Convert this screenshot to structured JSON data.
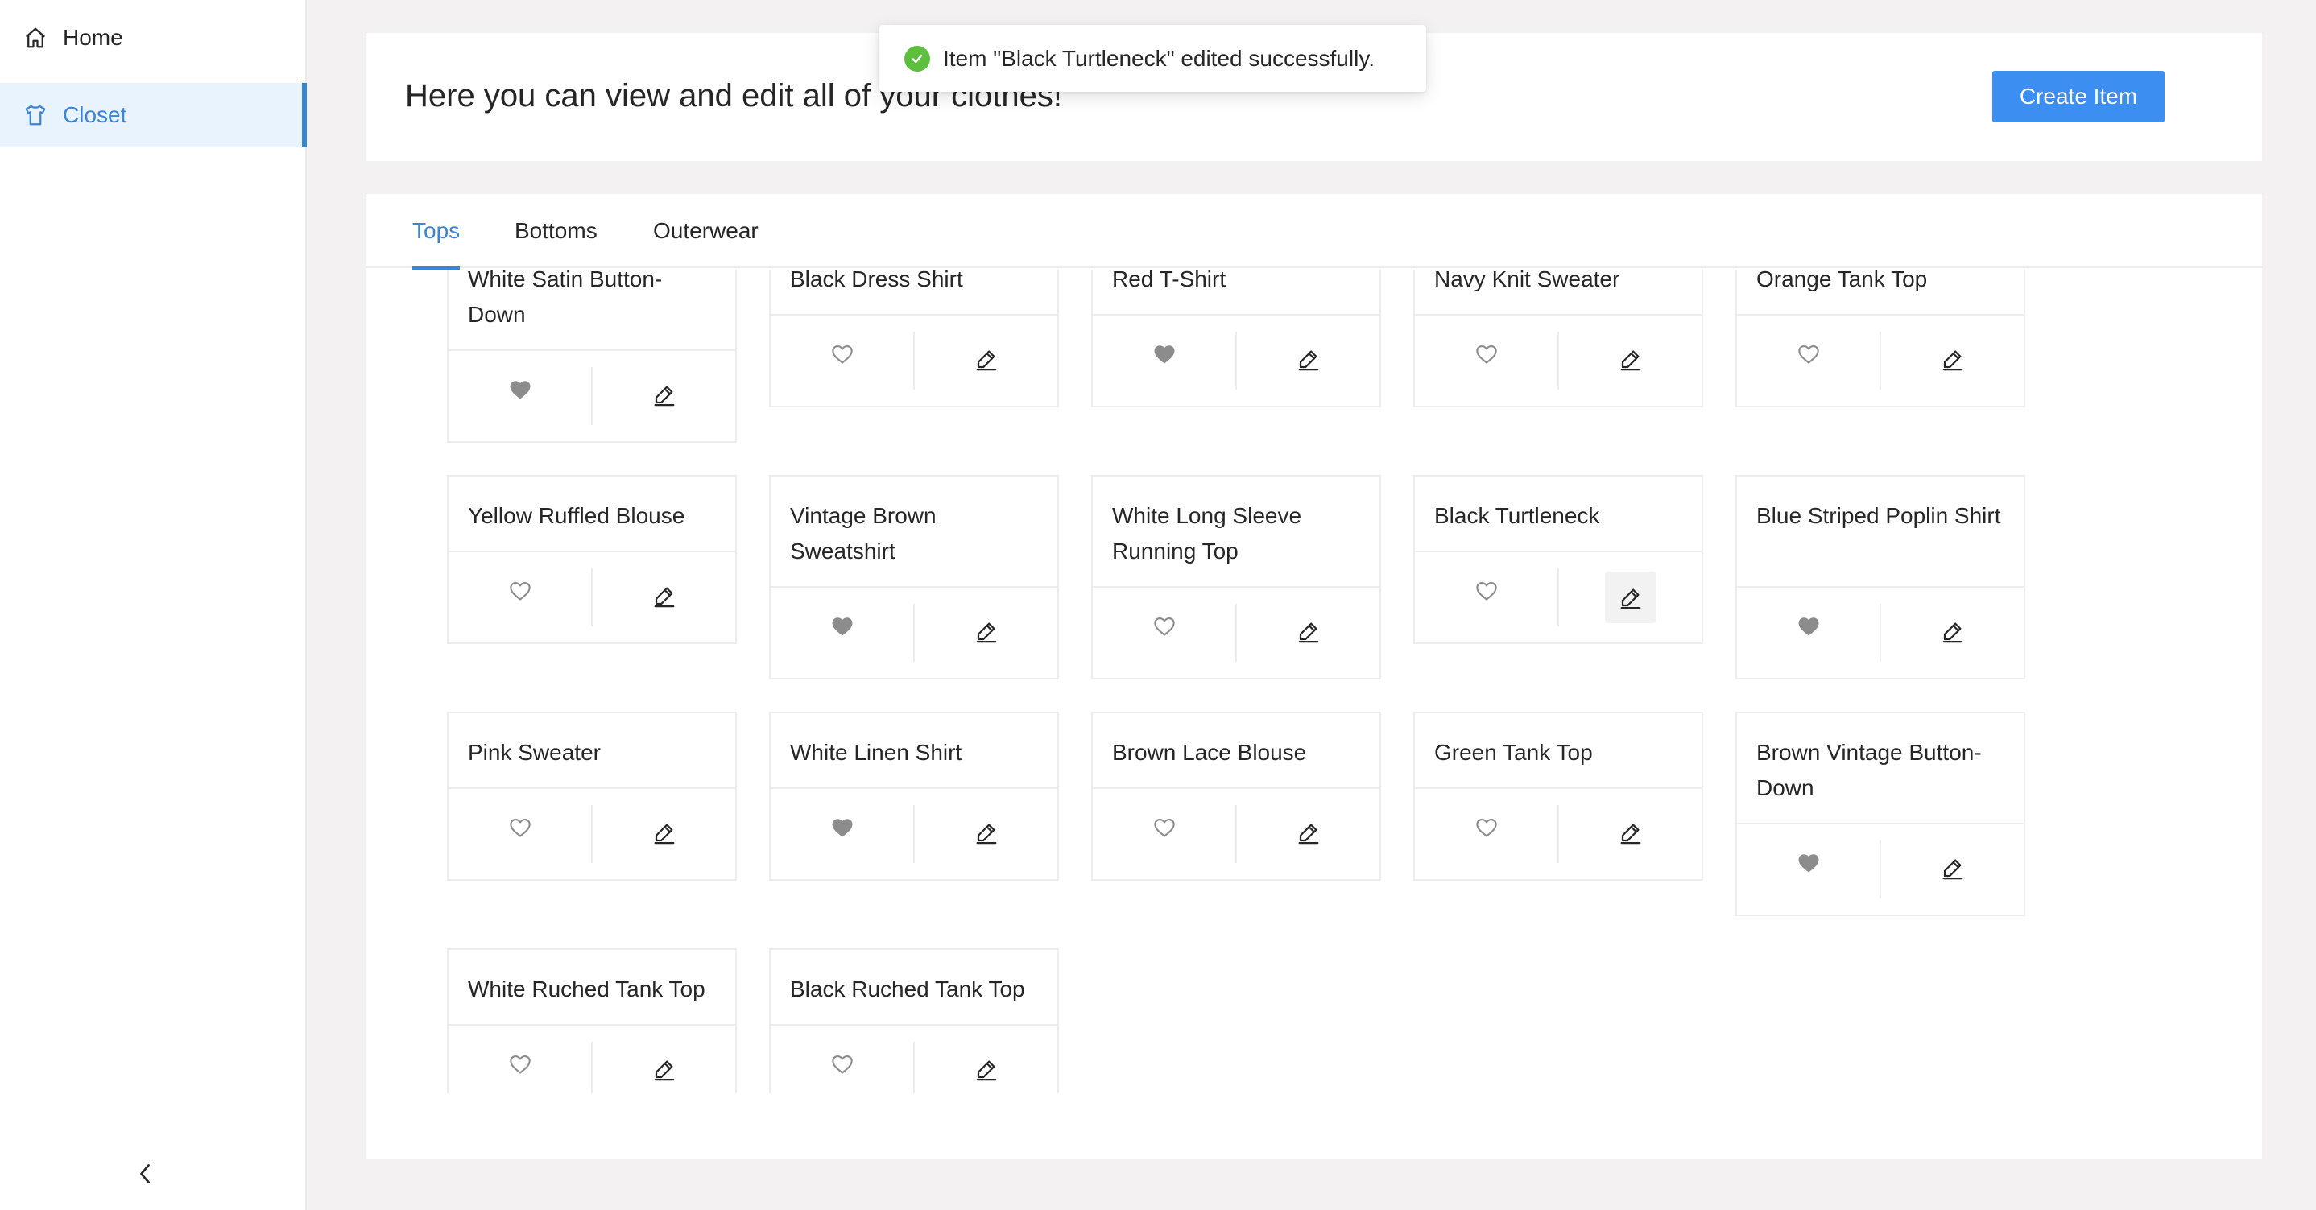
{
  "sidebar": {
    "items": [
      {
        "label": "Home",
        "icon": "home-icon"
      },
      {
        "label": "Closet",
        "icon": "shirt-icon",
        "selected": true
      }
    ],
    "collapse_icon": "chevron-left-icon"
  },
  "header": {
    "title": "Here you can view and edit all of your clothes!",
    "create_button": "Create Item"
  },
  "toast": {
    "message": "Item \"Black Turtleneck\" edited successfully.",
    "status_color": "#5cbf3e"
  },
  "tabs": [
    {
      "label": "Tops",
      "active": true
    },
    {
      "label": "Bottoms",
      "active": false
    },
    {
      "label": "Outerwear",
      "active": false
    }
  ],
  "items": [
    {
      "name": "White Satin Button-Down",
      "favorite": true
    },
    {
      "name": "Black Dress Shirt",
      "favorite": false
    },
    {
      "name": "Red T-Shirt",
      "favorite": true
    },
    {
      "name": "Navy Knit Sweater",
      "favorite": false
    },
    {
      "name": "Orange Tank Top",
      "favorite": false
    },
    {
      "name": "Yellow Ruffled Blouse",
      "favorite": false
    },
    {
      "name": "Vintage Brown Sweatshirt",
      "favorite": true
    },
    {
      "name": "White Long Sleeve Running Top",
      "favorite": false
    },
    {
      "name": "Black Turtleneck",
      "favorite": false
    },
    {
      "name": "Blue Striped Poplin Shirt",
      "favorite": true
    },
    {
      "name": "Pink Sweater",
      "favorite": false
    },
    {
      "name": "White Linen Shirt",
      "favorite": true
    },
    {
      "name": "Brown Lace Blouse",
      "favorite": false
    },
    {
      "name": "Green Tank Top",
      "favorite": false
    },
    {
      "name": "Brown Vintage Button-Down",
      "favorite": true
    },
    {
      "name": "White Ruched Tank Top",
      "favorite": false
    },
    {
      "name": "Black Ruched Tank Top",
      "favorite": false
    }
  ],
  "colors": {
    "accent": "#3a86d6",
    "button": "#3c8ef0",
    "favorite_fill": "#8c8c8c"
  }
}
